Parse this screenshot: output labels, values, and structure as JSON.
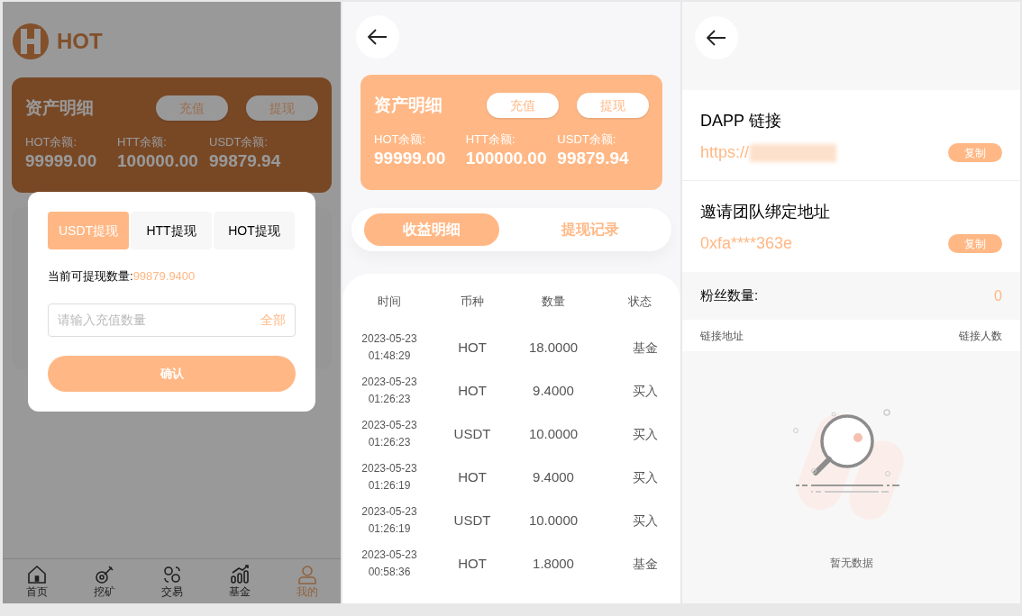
{
  "withdraw_screen": {
    "logo_text": "HOT",
    "asset_card": {
      "title": "资产明细",
      "buttons": [
        "充值",
        "提现"
      ],
      "balances": [
        {
          "label": "HOT余额:",
          "value": "99999.00"
        },
        {
          "label": "HTT余额:",
          "value": "100000.00"
        },
        {
          "label": "USDT余额:",
          "value": "99879.94"
        }
      ]
    },
    "dialog": {
      "tabs": [
        {
          "label": "USDT提现",
          "selected": true
        },
        {
          "label": "HTT提现",
          "selected": false
        },
        {
          "label": "HOT提现",
          "selected": false
        }
      ],
      "available_label": "当前可提现数量:",
      "available_value": "99879.9400",
      "amount_field": {
        "placeholder": "请输入充值数量",
        "action": "全部"
      },
      "confirm_button": "确认"
    },
    "bottom_nav": [
      {
        "label": "首页",
        "selected": false
      },
      {
        "label": "挖矿",
        "selected": false
      },
      {
        "label": "交易",
        "selected": false
      },
      {
        "label": "基金",
        "selected": false
      },
      {
        "label": "我的",
        "selected": true
      }
    ]
  },
  "income_screen": {
    "asset_card": {
      "title": "资产明细",
      "buttons": [
        "充值",
        "提现"
      ],
      "balances": [
        {
          "label": "HOT余额:",
          "value": "99999.00"
        },
        {
          "label": "HTT余额:",
          "value": "100000.00"
        },
        {
          "label": "USDT余额:",
          "value": "99879.94"
        }
      ]
    },
    "tabs": [
      {
        "label": "收益明细",
        "selected": true
      },
      {
        "label": "提现记录",
        "selected": false
      }
    ],
    "table": {
      "columns": [
        "时间",
        "币种",
        "数量",
        "状态"
      ],
      "rows": [
        {
          "time": "2023-05-23 01:48:29",
          "coin": "HOT",
          "amount": "18.0000",
          "status": "基金"
        },
        {
          "time": "2023-05-23 01:26:23",
          "coin": "HOT",
          "amount": "9.4000",
          "status": "买入"
        },
        {
          "time": "2023-05-23 01:26:23",
          "coin": "USDT",
          "amount": "10.0000",
          "status": "买入"
        },
        {
          "time": "2023-05-23 01:26:19",
          "coin": "HOT",
          "amount": "9.4000",
          "status": "买入"
        },
        {
          "time": "2023-05-23 01:26:19",
          "coin": "USDT",
          "amount": "10.0000",
          "status": "买入"
        },
        {
          "time": "2023-05-23 00:58:36",
          "coin": "HOT",
          "amount": "1.8000",
          "status": "基金"
        }
      ]
    }
  },
  "invite_screen": {
    "links": [
      {
        "title": "DAPP 链接",
        "value": "https://",
        "value_redacted": true,
        "button": "复制"
      },
      {
        "title": "邀请团队绑定地址",
        "value": "0xfa****363e",
        "value_redacted": false,
        "button": "复制"
      }
    ],
    "fans": {
      "label": "粉丝数量:",
      "count": "0"
    },
    "list_columns": [
      "链接地址",
      "链接人数"
    ],
    "empty_text": "暂无数据"
  }
}
